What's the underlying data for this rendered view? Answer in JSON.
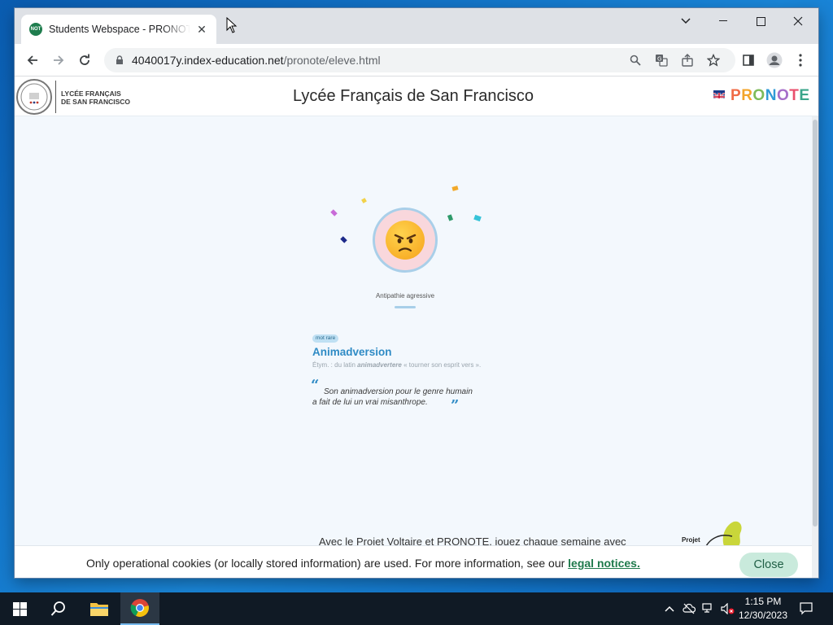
{
  "browser": {
    "tab_title": "Students Webspace - PRONOTE",
    "tab_favicon_text": "NOT",
    "url_host": "4040017y.index-education.net",
    "url_path": "/pronote/eleve.html"
  },
  "header": {
    "school_name_line1": "LYCÉE FRANÇAIS",
    "school_name_line2": "DE SAN FRANCISCO",
    "title": "Lycée Français de San Francisco",
    "brand": "PRONOTE",
    "brand_colors": [
      "#f06b46",
      "#f3a52b",
      "#7dbb5a",
      "#2f9ad6",
      "#a66ec9",
      "#e94f6d",
      "#3aa58a"
    ]
  },
  "word_of_week": {
    "mood_caption": "Antipathie agressive",
    "tag": "mot rare",
    "word": "Animadversion",
    "etymology_prefix": "Étym. : du latin ",
    "etymology_latin": "animadvertere",
    "etymology_suffix": " « tourner son esprit vers ».",
    "quote_line1": "Son animadversion pour le genre humain",
    "quote_line2": "a fait de lui un vrai misanthrope."
  },
  "voltaire": {
    "text": "Avec le Projet Voltaire et PRONOTE, jouez chaque semaine avec",
    "logo_text": "Projet"
  },
  "cookie_bar": {
    "text": "Only operational cookies (or locally stored information) are used. For more information, see our ",
    "link": "legal notices.",
    "close_label": "Close"
  },
  "taskbar": {
    "time": "1:15 PM",
    "date": "12/30/2023"
  }
}
